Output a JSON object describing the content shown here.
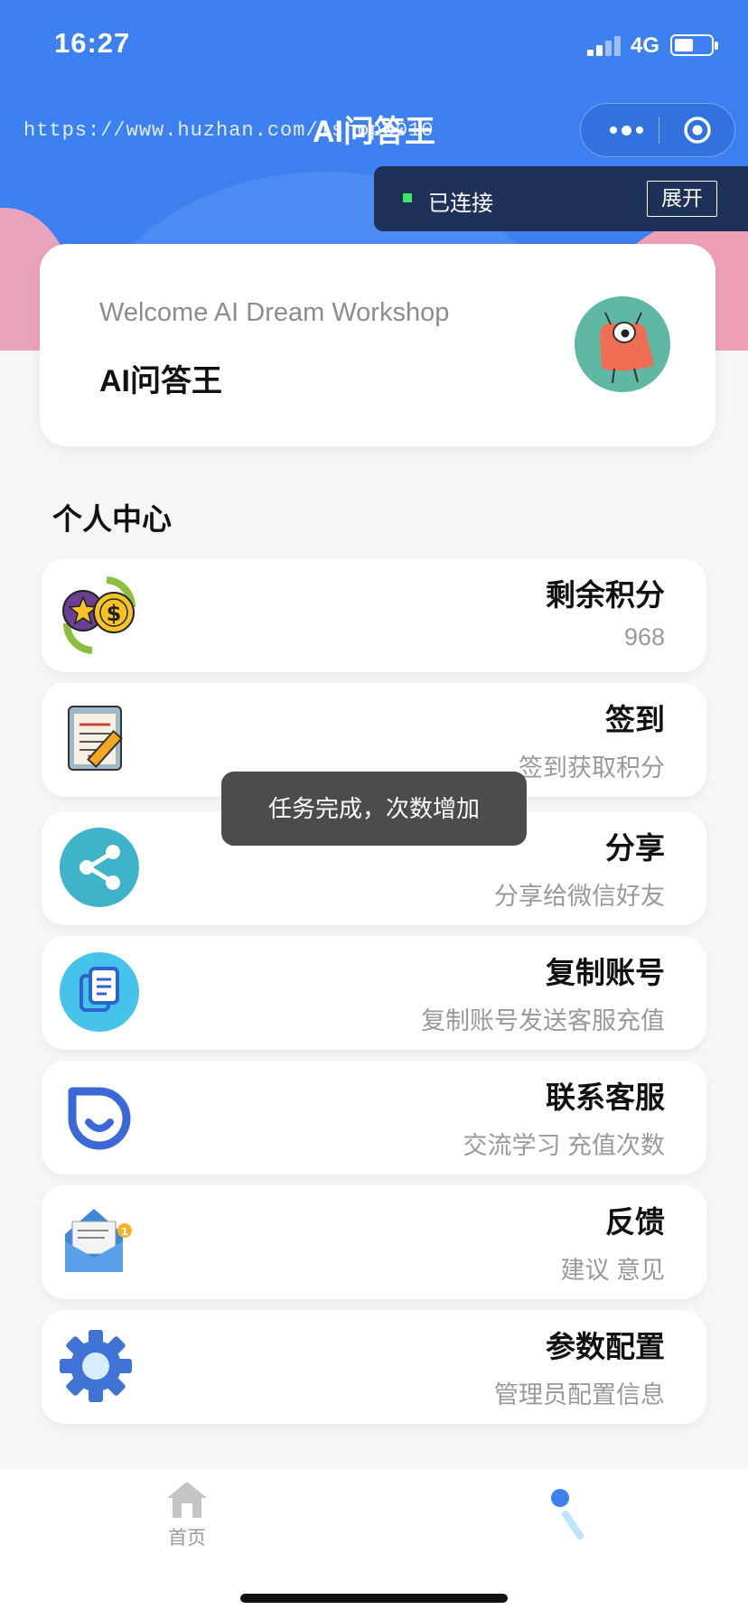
{
  "status_bar": {
    "time": "16:27",
    "network": "4G"
  },
  "nav": {
    "title": "AI问答王",
    "watermark": "https://www.huzhan.com/ishop0010"
  },
  "connection": {
    "status": "已连接",
    "expand_label": "展开"
  },
  "welcome": {
    "subtitle": "Welcome AI Dream Workshop",
    "title": "AI问答王"
  },
  "section_title": "个人中心",
  "menu": [
    {
      "label": "剩余积分",
      "desc": "968",
      "icon": "points-exchange-icon"
    },
    {
      "label": "签到",
      "desc": "签到获取积分",
      "icon": "checkin-notepad-icon"
    },
    {
      "label": "分享",
      "desc": "分享给微信好友",
      "icon": "share-icon"
    },
    {
      "label": "复制账号",
      "desc": "复制账号发送客服充值",
      "icon": "copy-documents-icon"
    },
    {
      "label": "联系客服",
      "desc": "交流学习 充值次数",
      "icon": "customer-service-icon"
    },
    {
      "label": "反馈",
      "desc": "建议 意见",
      "icon": "feedback-mail-icon"
    },
    {
      "label": "参数配置",
      "desc": "管理员配置信息",
      "icon": "settings-gear-icon"
    }
  ],
  "toast": "任务完成，次数增加",
  "tabbar": {
    "home_label": "首页"
  },
  "colors": {
    "primary": "#3d80ef",
    "nav_dark": "#1e3159",
    "pink": "#eda0b6",
    "toast": "#4c4c4c"
  }
}
